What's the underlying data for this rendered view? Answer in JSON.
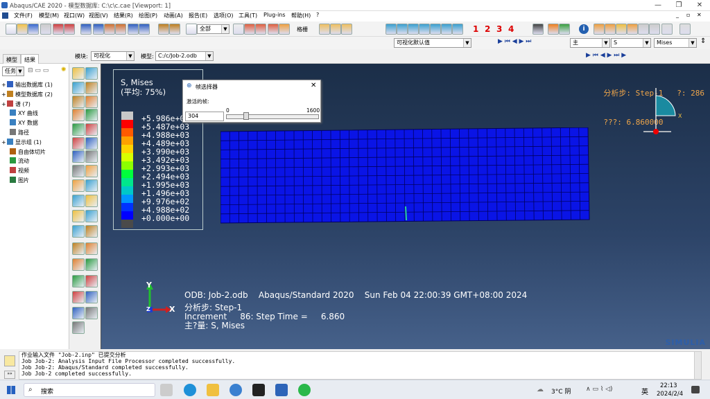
{
  "window": {
    "title": "Abaqus/CAE 2020 - 模型数据库: C:\\c\\c.cae [Viewport: 1]"
  },
  "menu": [
    "文件(F)",
    "模型(M)",
    "视口(W)",
    "视图(V)",
    "结果(R)",
    "绘图(P)",
    "动画(A)",
    "报告(E)",
    "选项(O)",
    "工具(T)",
    "Plug-ins",
    "帮助(H)",
    "?"
  ],
  "toolbar": {
    "selection_filter": "全部",
    "field_style": "格栅",
    "step_numbers": [
      "1",
      "2",
      "3",
      "4"
    ],
    "view_default": "可视化默认值",
    "invariant_main": "主",
    "variable": "S",
    "invariant": "Mises"
  },
  "context": {
    "module_label": "模块:",
    "module_value": "可视化",
    "model_label": "模型:",
    "model_value": "C:/c/Job-2.odb"
  },
  "left_panel": {
    "tabs": [
      "模型",
      "结果"
    ],
    "active_tab": "结果",
    "task_label": "任务数",
    "tree": [
      {
        "label": "输出数据库 (1)",
        "expander": "+",
        "indent": 0
      },
      {
        "label": "模型数据库 (2)",
        "expander": "+",
        "indent": 0
      },
      {
        "label": "谱 (7)",
        "expander": "+",
        "indent": 0
      },
      {
        "label": "XY 曲线",
        "expander": "",
        "indent": 1
      },
      {
        "label": "XY 数据",
        "expander": "",
        "indent": 1
      },
      {
        "label": "路径",
        "expander": "",
        "indent": 1
      },
      {
        "label": "显示组 (1)",
        "expander": "+",
        "indent": 0
      },
      {
        "label": "自由体切片",
        "expander": "",
        "indent": 1
      },
      {
        "label": "流动",
        "expander": "",
        "indent": 1
      },
      {
        "label": "视频",
        "expander": "",
        "indent": 1
      },
      {
        "label": "图片",
        "expander": "",
        "indent": 1
      }
    ]
  },
  "legend": {
    "title": "S, Mises",
    "subtitle": "(平均: 75%)",
    "values": [
      "+5.986e+03",
      "+5.487e+03",
      "+4.988e+03",
      "+4.489e+03",
      "+3.990e+03",
      "+3.492e+03",
      "+2.993e+03",
      "+2.494e+03",
      "+1.995e+03",
      "+1.496e+03",
      "+9.976e+02",
      "+4.988e+02",
      "+0.000e+00"
    ],
    "colors": [
      "#c8c8c8",
      "#ff0000",
      "#ff5a00",
      "#ffa000",
      "#ffd200",
      "#d8ff00",
      "#8cff00",
      "#00ff3c",
      "#00e68c",
      "#00c8c8",
      "#0096ff",
      "#0032ff",
      "#0000ff",
      "#4a4a4a"
    ]
  },
  "viewport": {
    "step_label": "分析步: Step-1",
    "frame_label": "?: 286",
    "time_label": "???: 6.860000",
    "odb_line": "ODB: Job-2.odb    Abaqus/Standard 2020    Sun Feb 04 22:00:39 GMT+08:00 2024",
    "step_line": "分析步: Step-1",
    "increment_line": "Increment     86: Step Time =     6.860",
    "variable_line": "主?量: S, Mises",
    "axis_y": "Y",
    "axis_x": "X",
    "axis_z": "Z",
    "triad_x": "X",
    "mesh_color": "#0a14e6",
    "mesh_line_color": "#000060",
    "brand": "SIMULIA"
  },
  "filter_dialog": {
    "title": "帧选择器",
    "label": "激活的帧:",
    "value": "304",
    "min": "0",
    "max": "1600",
    "position": 0.19
  },
  "messages": [
    "作业输入文件 \"Job-2.inp\" 已提交分析",
    "Job Job-2: Analysis Input File Processor completed successfully.",
    "Job Job-2: Abaqus/Standard completed successfully.",
    "Job Job-2 completed successfully."
  ],
  "taskbar": {
    "search": "搜索",
    "weather": "3°C 阴",
    "lang": "英",
    "time": "22:13",
    "date": "2024/2/4"
  }
}
